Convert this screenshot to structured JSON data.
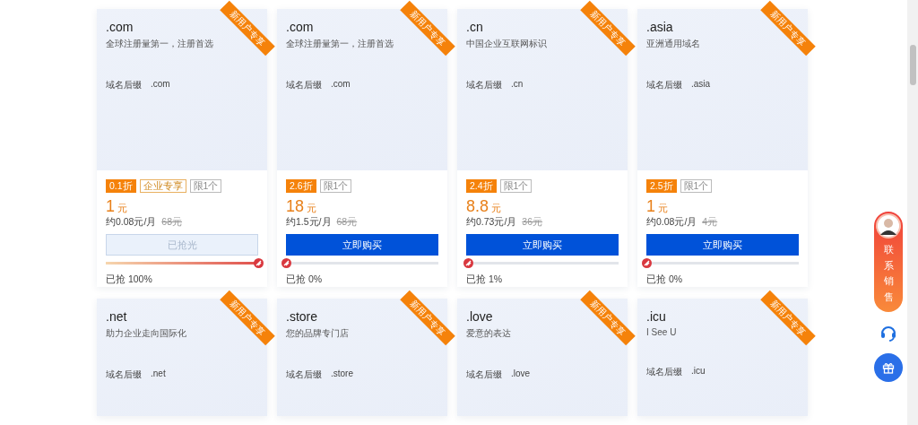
{
  "cards": [
    {
      "ribbon": "新用户专享",
      "name": ".com",
      "desc": "全球注册量第一，注册首选",
      "suffix_label": "域名后缀",
      "suffix": ".com",
      "tags": [
        {
          "kind": "discount",
          "text": "0.1折"
        },
        {
          "kind": "enterprise",
          "text": "企业专享"
        },
        {
          "kind": "limit",
          "text": "限1个"
        }
      ],
      "price": "1",
      "unit": "元",
      "monthly": "约0.08元/月",
      "original": "68元",
      "button": {
        "label": "已抢光",
        "disabled": true
      },
      "level": 1,
      "sold": "已抢 100%"
    },
    {
      "ribbon": "新用户专享",
      "name": ".com",
      "desc": "全球注册量第一，注册首选",
      "suffix_label": "域名后缀",
      "suffix": ".com",
      "tags": [
        {
          "kind": "discount",
          "text": "2.6折"
        },
        {
          "kind": "limit",
          "text": "限1个"
        }
      ],
      "price": "18",
      "unit": "元",
      "monthly": "约1.5元/月",
      "original": "68元",
      "button": {
        "label": "立即购买",
        "disabled": false
      },
      "level": 0,
      "sold": "已抢 0%"
    },
    {
      "ribbon": "新用户专享",
      "name": ".cn",
      "desc": "中国企业互联网标识",
      "suffix_label": "域名后缀",
      "suffix": ".cn",
      "tags": [
        {
          "kind": "discount",
          "text": "2.4折"
        },
        {
          "kind": "limit",
          "text": "限1个"
        }
      ],
      "price": "8.8",
      "unit": "元",
      "monthly": "约0.73元/月",
      "original": "36元",
      "button": {
        "label": "立即购买",
        "disabled": false
      },
      "level": 0.01,
      "sold": "已抢 1%"
    },
    {
      "ribbon": "新用户专享",
      "name": ".asia",
      "desc": "亚洲通用域名",
      "suffix_label": "域名后缀",
      "suffix": ".asia",
      "tags": [
        {
          "kind": "discount",
          "text": "2.5折"
        },
        {
          "kind": "limit",
          "text": "限1个"
        }
      ],
      "price": "1",
      "unit": "元",
      "monthly": "约0.08元/月",
      "original": "4元",
      "button": {
        "label": "立即购买",
        "disabled": false
      },
      "level": 0,
      "sold": "已抢 0%"
    },
    {
      "ribbon": "新用户专享",
      "name": ".net",
      "desc": "助力企业走向国际化",
      "suffix_label": "域名后缀",
      "suffix": ".net"
    },
    {
      "ribbon": "新用户专享",
      "name": ".store",
      "desc": "您的品牌专门店",
      "suffix_label": "域名后缀",
      "suffix": ".store"
    },
    {
      "ribbon": "新用户专享",
      "name": ".love",
      "desc": "爱意的表达",
      "suffix_label": "域名后缀",
      "suffix": ".love"
    },
    {
      "ribbon": "新用户专享",
      "name": ".icu",
      "desc": "I See U",
      "suffix_label": "域名后缀",
      "suffix": ".icu"
    }
  ],
  "sales_widget": {
    "label": "联系销售"
  }
}
